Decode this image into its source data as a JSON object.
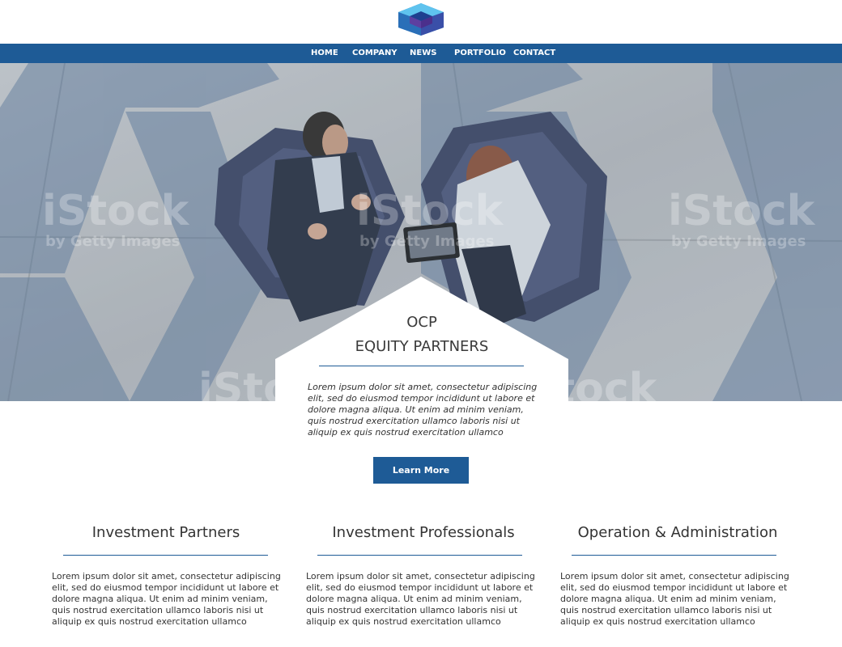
{
  "header": {
    "logo_icon": "hexagon-cube-logo-icon"
  },
  "nav": {
    "items": [
      {
        "label": "HOME"
      },
      {
        "label": "COMPANY"
      },
      {
        "label": "NEWS"
      },
      {
        "label": "PORTFOLIO"
      },
      {
        "label": "CONTACT"
      }
    ]
  },
  "hero": {
    "watermark_main": "iStock",
    "watermark_sub": "by Getty Images",
    "title_line1": "OCP",
    "title_line2": "EQUITY PARTNERS",
    "body": "Lorem ipsum dolor sit amet, consectetur adipiscing elit, sed do eiusmod tempor incididunt ut labore et dolore magna aliqua. Ut enim ad minim veniam, quis nostrud exercitation ullamco laboris nisi ut aliquip ex quis nostrud exercitation ullamco",
    "button_label": "Learn More"
  },
  "columns": [
    {
      "title": "Investment Partners",
      "body": "Lorem ipsum dolor sit amet, consectetur adipiscing elit, sed do eiusmod tempor incididunt ut labore et dolore magna aliqua. Ut enim ad minim veniam, quis nostrud exercitation ullamco laboris nisi ut aliquip ex quis nostrud exercitation ullamco"
    },
    {
      "title": "Investment Professionals",
      "body": "Lorem ipsum dolor sit amet, consectetur adipiscing elit, sed do eiusmod tempor incididunt ut labore et dolore magna aliqua. Ut enim ad minim veniam, quis nostrud exercitation ullamco laboris nisi ut aliquip ex quis nostrud exercitation ullamco"
    },
    {
      "title": "Operation & Administration",
      "body": "Lorem ipsum dolor sit amet, consectetur adipiscing elit, sed do eiusmod tempor incididunt ut labore et dolore magna aliqua. Ut enim ad minim veniam, quis nostrud exercitation ullamco laboris nisi ut aliquip ex quis nostrud exercitation ullamco"
    }
  ],
  "colors": {
    "accent": "#1e5b96",
    "text": "#333333",
    "hero_tint": "#7f93ad"
  }
}
